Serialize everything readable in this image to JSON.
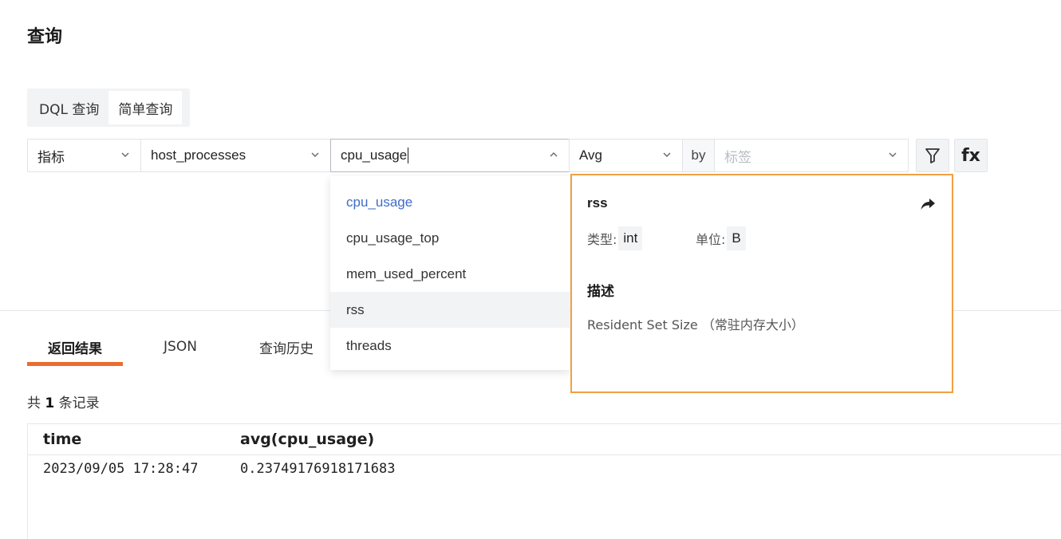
{
  "page": {
    "title": "查询"
  },
  "mode_tabs": [
    {
      "label": "DQL 查询"
    },
    {
      "label": "简单查询"
    }
  ],
  "query": {
    "data_type": "指标",
    "measurement": "host_processes",
    "field_value": "cpu_usage",
    "aggregation": "Avg",
    "by_label": "by",
    "tag_placeholder": "标签",
    "fx_label": "fx"
  },
  "field_dropdown": {
    "items": [
      {
        "label": "cpu_usage"
      },
      {
        "label": "cpu_usage_top"
      },
      {
        "label": "mem_used_percent"
      },
      {
        "label": "rss"
      },
      {
        "label": "threads"
      }
    ]
  },
  "field_detail": {
    "name": "rss",
    "type_label": "类型:",
    "type_value": "int",
    "unit_label": "单位:",
    "unit_value": "B",
    "desc_title": "描述",
    "desc_text": "Resident Set Size （常驻内存大小）",
    "accent_color": "#f0a043"
  },
  "result_tabs": [
    {
      "label": "返回结果"
    },
    {
      "label": "JSON"
    },
    {
      "label": "查询历史"
    }
  ],
  "record_count": {
    "prefix": "共",
    "count": "1",
    "suffix": "条记录"
  },
  "table": {
    "columns": [
      "time",
      "avg(cpu_usage)"
    ],
    "rows": [
      [
        "2023/09/05 17:28:47",
        "0.23749176918171683"
      ]
    ]
  },
  "colors": {
    "accent_orange": "#ec6b2d",
    "link_blue": "#3d6dcc"
  }
}
